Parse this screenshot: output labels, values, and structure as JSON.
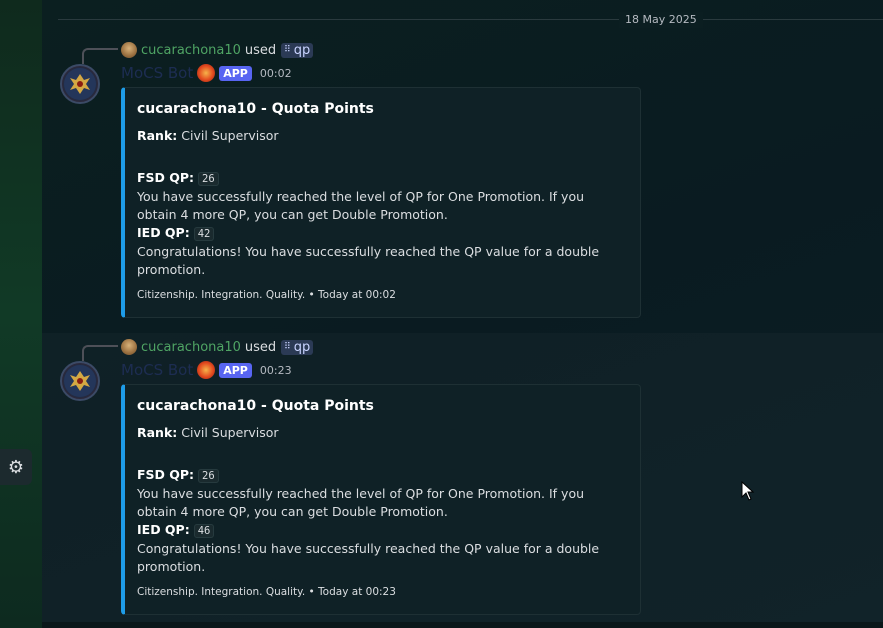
{
  "date_divider": "18 May 2025",
  "messages": [
    {
      "reply": {
        "user": "cucarachona10",
        "used": "used",
        "command": "qp"
      },
      "bot_name": "MoCS Bot",
      "app_tag": "APP",
      "time": "00:02",
      "embed": {
        "title": "cucarachona10 - Quota Points",
        "rank_label": "Rank:",
        "rank_value": "Civil Supervisor",
        "fsd_label": "FSD QP:",
        "fsd_value": "26",
        "fsd_text": "You have successfully reached the level of QP for One Promotion. If you obtain 4 more QP, you can get Double Promotion.",
        "ied_label": "IED QP:",
        "ied_value": "42",
        "ied_text": "Congratulations! You have successfully reached the QP value for a double promotion.",
        "footer": "Citizenship. Integration. Quality. • Today at 00:02"
      }
    },
    {
      "reply": {
        "user": "cucarachona10",
        "used": "used",
        "command": "qp"
      },
      "bot_name": "MoCS Bot",
      "app_tag": "APP",
      "time": "00:23",
      "embed": {
        "title": "cucarachona10 - Quota Points",
        "rank_label": "Rank:",
        "rank_value": "Civil Supervisor",
        "fsd_label": "FSD QP:",
        "fsd_value": "26",
        "fsd_text": "You have successfully reached the level of QP for One Promotion. If you obtain 4 more QP, you can get Double Promotion.",
        "ied_label": "IED QP:",
        "ied_value": "46",
        "ied_text": "Congratulations! You have successfully reached the QP value for a double promotion.",
        "footer": "Citizenship. Integration. Quality. • Today at 00:23"
      }
    }
  ],
  "icons": {
    "settings": "gear-icon",
    "command": "app-command-icon",
    "cursor": "mouse-cursor-icon"
  },
  "colors": {
    "accent": "#1e9ce8",
    "app_tag": "#5865f2",
    "reply_user": "#4fa464"
  }
}
